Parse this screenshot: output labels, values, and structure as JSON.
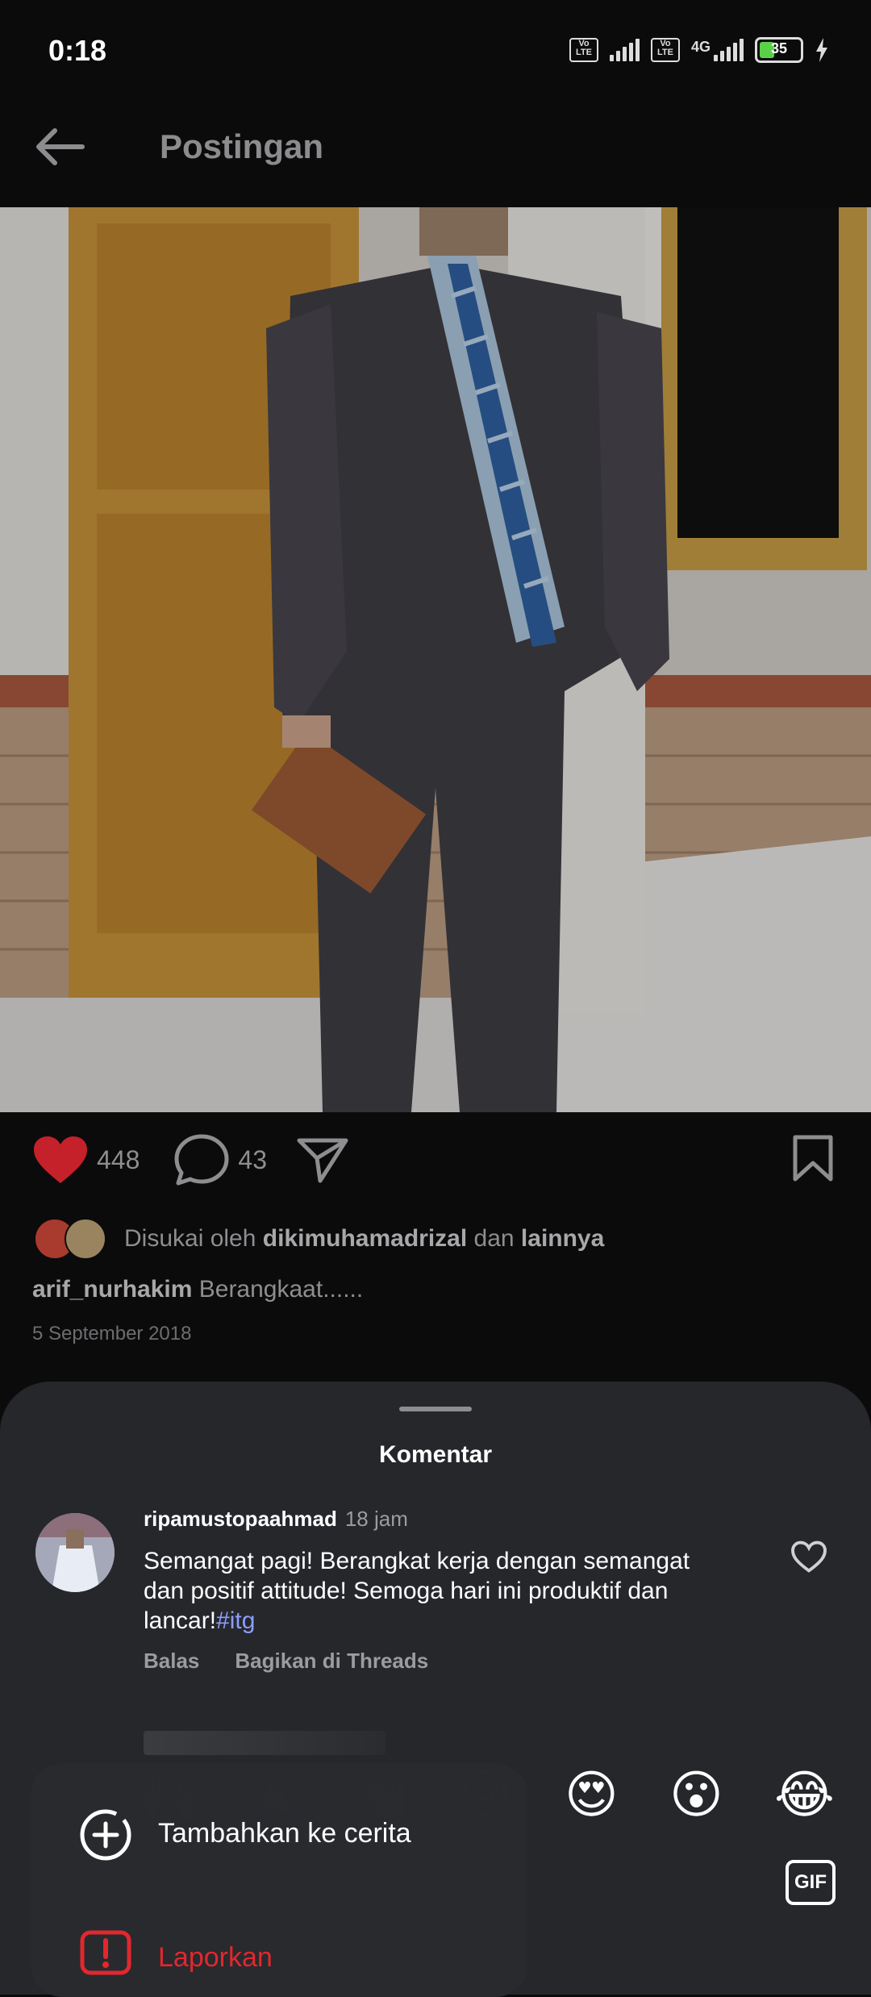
{
  "status_bar": {
    "time": "0:18",
    "battery": "35",
    "network": "4G",
    "volte_label": "Vo LTE"
  },
  "header": {
    "title": "Postingan"
  },
  "post": {
    "likes_count": "448",
    "comments_count": "43",
    "liked_by_prefix": "Disukai oleh",
    "liked_by_user": "dikimuhamadrizal",
    "liked_by_and": "dan",
    "liked_by_others": "lainnya",
    "caption_user": "arif_nurhakim",
    "caption_text": "Berangkaat......",
    "date": "5 September 2018"
  },
  "comments_sheet": {
    "title": "Komentar",
    "comments": [
      {
        "user": "ripamustopaahmad",
        "time": "18 jam",
        "text": "Semangat pagi! Berangkat kerja dengan semangat dan positif attitude! Semoga hari ini produktif dan lancar!",
        "hashtag": "#itg",
        "reply_label": "Balas",
        "share_label": "Bagikan di Threads"
      }
    ]
  },
  "reactions": [
    "🙌",
    "🙏",
    "👏",
    "😢",
    "😍",
    "😮",
    "😂"
  ],
  "gif_label": "GIF",
  "menu": {
    "add_to_story": "Tambahkan ke cerita",
    "report": "Laporkan"
  },
  "colors": {
    "like_red": "#c4212b",
    "report_red": "#e0282e",
    "hashtag_blue": "#8d9dff",
    "battery_green": "#5bd14a"
  }
}
